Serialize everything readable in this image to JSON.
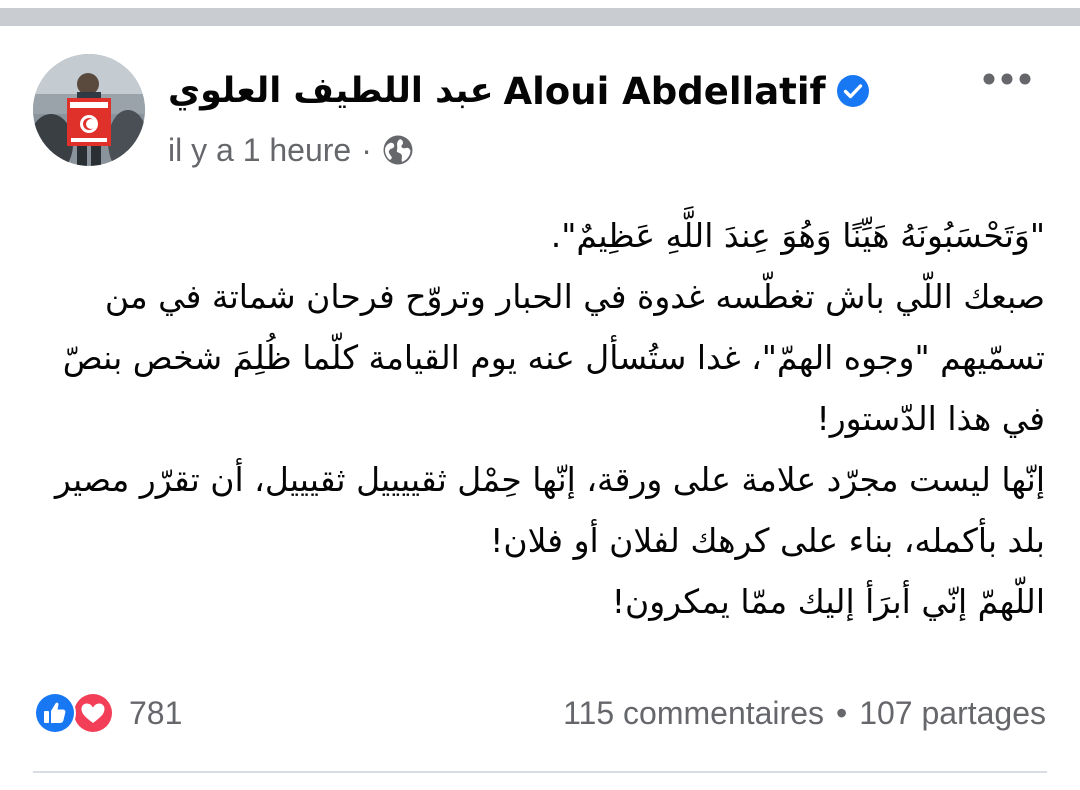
{
  "post": {
    "author_name_latin": "Aloui Abdellatif",
    "author_name_arabic": "عبد اللطيف العلوي",
    "timestamp": "il y a 1 heure",
    "separator": "·",
    "audience_icon": "globe-icon",
    "verified_icon": "verified-badge-icon",
    "more_icon": "more-options-icon",
    "body_lines": [
      "\"وَتَحْسَبُونَهُ هَيِّنًا وَهُوَ عِندَ اللَّهِ عَظِيمٌ\".",
      "صبعك اللّي باش تغطّسه غدوة في الحبار وتروّح فرحان شماتة في من تسمّيهم \"وجوه الهمّ\"، غدا ستُسأل عنه يوم القيامة كلّما ظُلِمَ شخص بنصّ في هذا الدّستور!",
      "إنّها ليست مجرّد علامة على ورقة، إنّها حِمْل ثقييييل ثقيييل، أن تقرّر مصير بلد بأكمله، بناء على كرهك لفلان أو فلان!",
      "اللّهمّ إنّي أبرَأ إليك ممّا يمكرون!"
    ]
  },
  "footer": {
    "reaction_icons": [
      "like-reaction-icon",
      "love-reaction-icon"
    ],
    "reaction_count": "781",
    "comments": "115 commentaires",
    "stats_separator": "•",
    "shares": "107 partages"
  },
  "colors": {
    "text_primary": "#050505",
    "text_secondary": "#65676b",
    "brand_blue": "#1877f2",
    "love_red": "#f33e58",
    "top_bar": "#c9ccd1",
    "divider": "#dadde1"
  }
}
